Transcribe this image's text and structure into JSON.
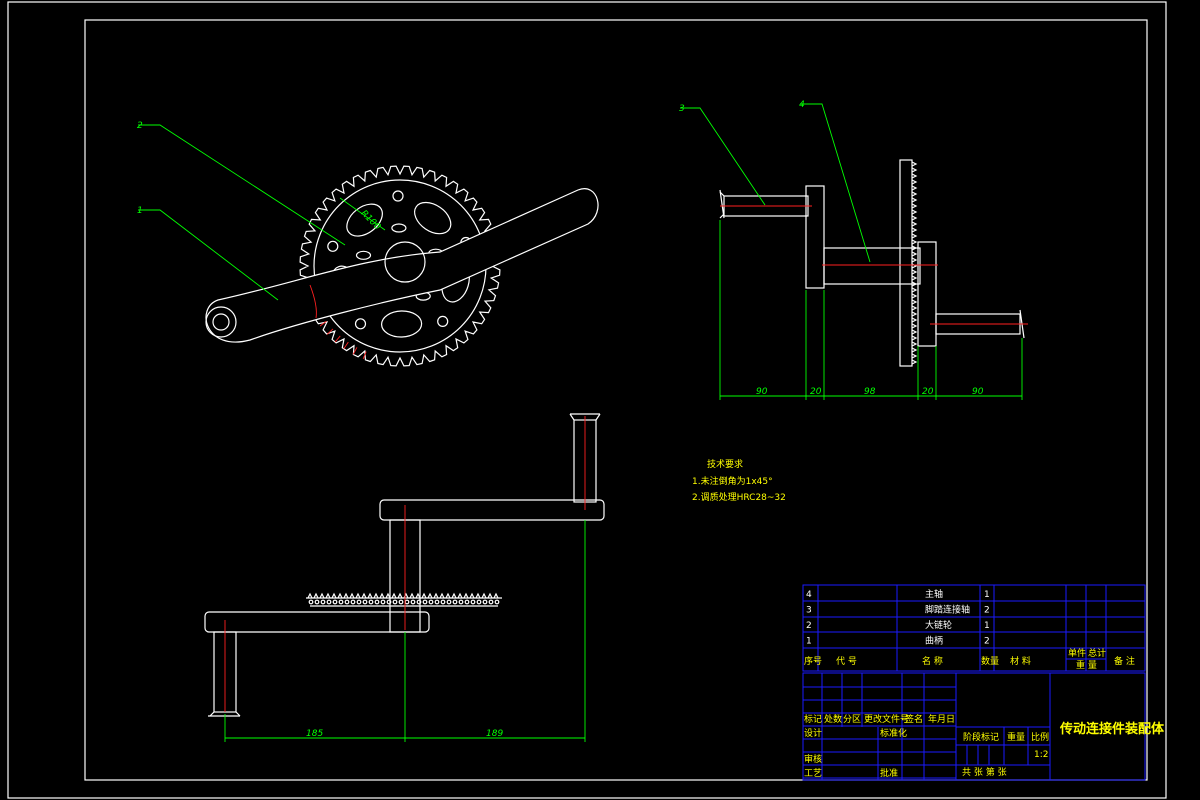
{
  "drawing": {
    "title": "传动连接件装配体"
  },
  "balloons": [
    "1",
    "2",
    "3",
    "4"
  ],
  "annotation_label": "R100",
  "dimensions": {
    "side_view": [
      "90",
      "20",
      "98",
      "20",
      "90"
    ],
    "bottom_view": [
      "185",
      "189"
    ]
  },
  "tech_requirements": {
    "heading": "技术要求",
    "lines": [
      "1.未注倒角为1x45°",
      "2.调质处理HRC28~32"
    ]
  },
  "parts_list": [
    {
      "no": "4",
      "name": "主轴",
      "qty": "1"
    },
    {
      "no": "3",
      "name": "脚踏连接轴",
      "qty": "2"
    },
    {
      "no": "2",
      "name": "大链轮",
      "qty": "1"
    },
    {
      "no": "1",
      "name": "曲柄",
      "qty": "2"
    }
  ],
  "parts_header": {
    "no": "序号",
    "code": "代 号",
    "name": "名 称",
    "qty": "数量",
    "material": "材 料",
    "unit_weight": "单件",
    "total_weight": "总计",
    "weight": "重 量",
    "remark": "备 注"
  },
  "title_block": {
    "mark": "标记",
    "count": "处数",
    "zone": "分区",
    "change_doc": "更改文件号",
    "sign": "签名",
    "date": "年月日",
    "design": "设计",
    "standardize": "标准化",
    "stage_mark": "阶段标记",
    "weight": "重量",
    "scale": "比例",
    "scale_value": "1:2",
    "review": "审核",
    "process": "工艺",
    "approve": "批准",
    "sheets": "共 张 第 张"
  }
}
